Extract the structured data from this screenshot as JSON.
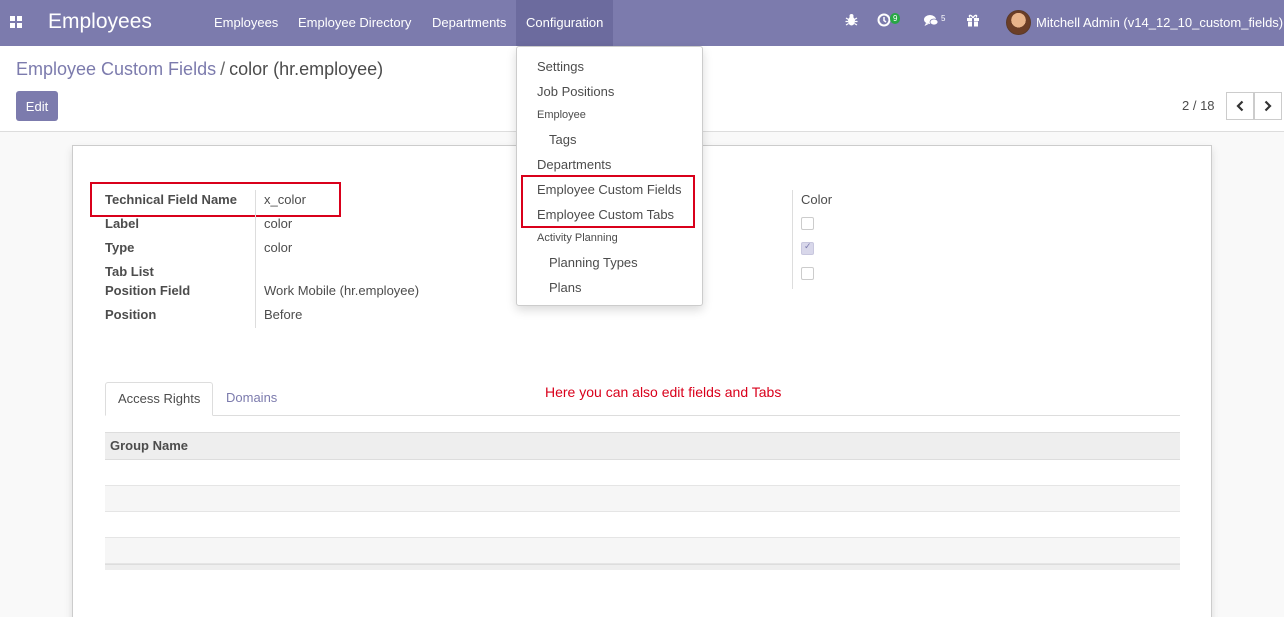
{
  "navbar": {
    "app_title": "Employees",
    "menu": [
      "Employees",
      "Employee Directory",
      "Departments",
      "Configuration"
    ],
    "active_menu": "Configuration",
    "activity_badge": "9",
    "messages_badge": "5",
    "user_label": "Mitchell Admin (v14_12_10_custom_fields)",
    "icons": [
      "apps-grid-icon",
      "bug-icon",
      "clock-icon",
      "chat-icon",
      "gift-icon"
    ]
  },
  "breadcrumb": {
    "parent": "Employee Custom Fields",
    "separator": "/",
    "current": "color (hr.employee)"
  },
  "toolbar": {
    "edit_label": "Edit"
  },
  "pager": {
    "value": "2 / 18"
  },
  "form": {
    "fields": [
      {
        "label": "Technical Field Name",
        "value": "x_color"
      },
      {
        "label": "Label",
        "value": "color"
      },
      {
        "label": "Type",
        "value": "color"
      },
      {
        "label": "Tab List",
        "value": ""
      },
      {
        "label": "Position Field",
        "value": "Work Mobile (hr.employee)"
      },
      {
        "label": "Position",
        "value": "Before"
      }
    ],
    "right_column": {
      "value": "Color",
      "checkboxes": [
        false,
        true,
        false
      ]
    }
  },
  "annotation": "Here you can also edit fields and Tabs",
  "tabs": [
    "Access Rights",
    "Domains"
  ],
  "active_tab": "Access Rights",
  "grid": {
    "columns": [
      "Group Name"
    ],
    "rows": []
  },
  "dropdown": {
    "items": [
      {
        "type": "item",
        "label": "Settings"
      },
      {
        "type": "item",
        "label": "Job Positions"
      },
      {
        "type": "header",
        "label": "Employee"
      },
      {
        "type": "sub",
        "label": "Tags"
      },
      {
        "type": "item",
        "label": "Departments"
      },
      {
        "type": "item",
        "label": "Employee Custom Fields"
      },
      {
        "type": "item",
        "label": "Employee Custom Tabs"
      },
      {
        "type": "header",
        "label": "Activity Planning"
      },
      {
        "type": "sub",
        "label": "Planning Types"
      },
      {
        "type": "sub",
        "label": "Plans"
      }
    ]
  },
  "colors": {
    "brand": "#7c7bad",
    "highlight_red": "#d9001b"
  }
}
